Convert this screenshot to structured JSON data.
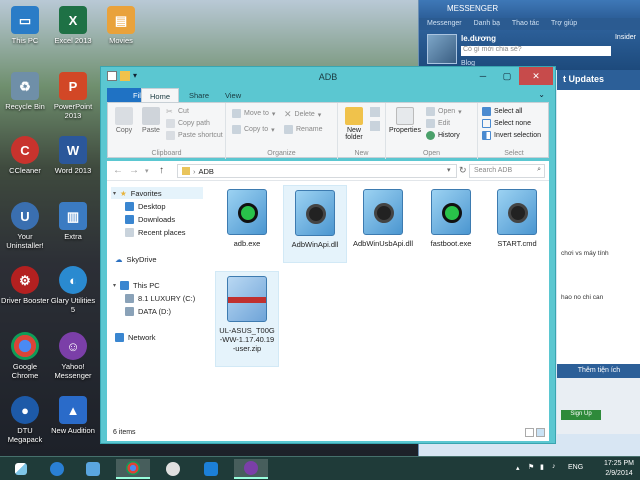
{
  "desktop": {
    "icons": [
      {
        "label": "This PC"
      },
      {
        "label": "Excel 2013"
      },
      {
        "label": "Movies"
      },
      {
        "label": "Recycle Bin"
      },
      {
        "label": "PowerPoint 2013"
      },
      {
        "label": "CCleaner"
      },
      {
        "label": "Word 2013"
      },
      {
        "label": "Your Uninstaller!"
      },
      {
        "label": "Extra"
      },
      {
        "label": "Driver Booster"
      },
      {
        "label": "Glary Utilities 5"
      },
      {
        "label": "Google Chrome"
      },
      {
        "label": "Yahoo! Messenger"
      },
      {
        "label": "DTU Megapack"
      },
      {
        "label": "New Audition"
      }
    ]
  },
  "messenger": {
    "title": "MESSENGER",
    "menu": [
      "Messenger",
      "Danh bạ",
      "Thao tác",
      "Trợ giúp"
    ],
    "username": "le.dương",
    "status_placeholder": "Có gì mới chia sẻ?",
    "insider": "Insider",
    "blog": "Blog",
    "updates": "t Updates",
    "snippet1": "chơi vs máy tính",
    "snippet2": "hao no chi can",
    "them_tien_ich": "Thêm tiện ích",
    "signup": "Sign Up"
  },
  "explorer": {
    "title": "ADB",
    "tabs": {
      "file": "File",
      "home": "Home",
      "share": "Share",
      "view": "View"
    },
    "ribbon": {
      "copy": "Copy",
      "paste": "Paste",
      "cut": "Cut",
      "copy_path": "Copy path",
      "paste_shortcut": "Paste shortcut",
      "clipboard": "Clipboard",
      "move_to": "Move to",
      "copy_to": "Copy to",
      "delete": "Delete",
      "rename": "Rename",
      "organize": "Organize",
      "new_folder": "New folder",
      "new": "New",
      "properties": "Properties",
      "open": "Open",
      "edit": "Edit",
      "history": "History",
      "open_group": "Open",
      "select_all": "Select all",
      "select_none": "Select none",
      "invert_selection": "Invert selection",
      "select_group": "Select"
    },
    "address": {
      "path": "ADB",
      "search_placeholder": "Search ADB"
    },
    "nav": {
      "favorites": "Favorites",
      "desktop": "Desktop",
      "downloads": "Downloads",
      "recent": "Recent places",
      "skydrive": "SkyDrive",
      "this_pc": "This PC",
      "drive_c": "8.1 LUXURY (C:)",
      "drive_d": "DATA (D:)",
      "network": "Network"
    },
    "files": [
      {
        "name": "adb.exe",
        "icon": "adb-app-icon"
      },
      {
        "name": "AdbWinApi.dll",
        "icon": "dll-gear-icon"
      },
      {
        "name": "AdbWinUsbApi.dll",
        "icon": "dll-gear-icon"
      },
      {
        "name": "fastboot.exe",
        "icon": "adb-app-icon"
      },
      {
        "name": "START.cmd",
        "icon": "cmd-gear-icon"
      },
      {
        "name": "UL-ASUS_T00G-WW-1.17.40.19-user.zip",
        "icon": "zip-archive-icon"
      }
    ],
    "status": "6 items"
  },
  "taskbar": {
    "lang": "ENG",
    "time": "17:25 PM",
    "date": "2/9/2014"
  }
}
